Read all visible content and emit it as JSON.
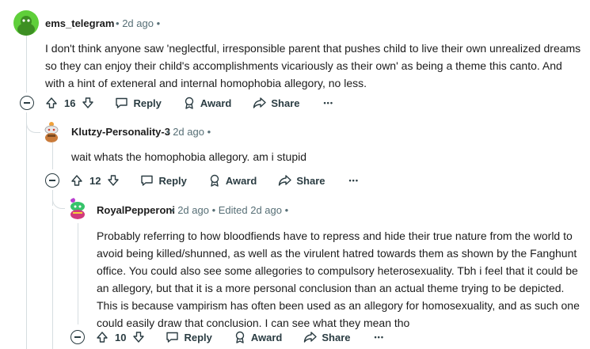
{
  "comments": [
    {
      "username": "ems_telegram",
      "time": "2d ago",
      "edited": "",
      "body": "I don't think anyone saw 'neglectful, irresponsible parent that pushes child to live their own unrealized dreams so they can enjoy their child's accomplishments vicariously as their own' as being a theme this canto. And with a hint of exteneral and internal homophobia allegory, no less.",
      "votes": "16",
      "reply_label": "Reply",
      "award_label": "Award",
      "share_label": "Share",
      "more_label": "•••"
    },
    {
      "username": "Klutzy-Personality-3",
      "time": "2d ago",
      "edited": "",
      "body": "wait whats the homophobia allegory. am i stupid",
      "votes": "12",
      "reply_label": "Reply",
      "award_label": "Award",
      "share_label": "Share",
      "more_label": "•••"
    },
    {
      "username": "RoyalPepperoni",
      "time": "2d ago",
      "edited": "Edited 2d ago",
      "body": "Probably referring to how bloodfiends have to repress and hide their true nature from the world to avoid being killed/shunned, as well as the virulent hatred towards them as shown by the Fanghunt office. You could also see some allegories to compulsory heterosexuality. Tbh i feel that it could be an allegory, but that it is a more personal conclusion than an actual theme trying to be depicted. This is because vampirism has often been used as an allegory for homosexuality, and as such one could easily draw that conclusion. I can see what they mean tho",
      "votes": "10",
      "reply_label": "Reply",
      "award_label": "Award",
      "share_label": "Share",
      "more_label": "•••"
    }
  ],
  "separator": "•",
  "colors": {
    "text": "#1c1c1c",
    "meta": "#576f76",
    "thread_line": "#d6dde0",
    "avatar1": "#5fcf3a"
  }
}
